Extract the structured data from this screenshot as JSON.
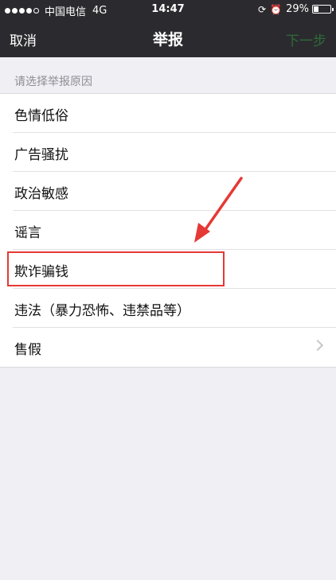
{
  "status_bar": {
    "carrier": "中国电信",
    "network": "4G",
    "time": "14:47",
    "battery": "29%",
    "battery_level": 0.29
  },
  "nav": {
    "left": "取消",
    "title": "举报",
    "right": "下一步"
  },
  "section_header": "请选择举报原因",
  "reasons": [
    {
      "label": "色情低俗"
    },
    {
      "label": "广告骚扰"
    },
    {
      "label": "政治敏感"
    },
    {
      "label": "谣言"
    },
    {
      "label": "欺诈骗钱"
    },
    {
      "label": "违法（暴力恐怖、违禁品等）"
    },
    {
      "label": "售假"
    }
  ],
  "colors": {
    "bar": "#2b2b2f",
    "next_disabled": "#2f6a38",
    "annotation": "#e53935",
    "background": "#efeff4"
  },
  "icons": [
    "signal-dots-icon",
    "rotation-lock-icon",
    "alarm-icon",
    "battery-icon",
    "chevron-right-icon"
  ]
}
